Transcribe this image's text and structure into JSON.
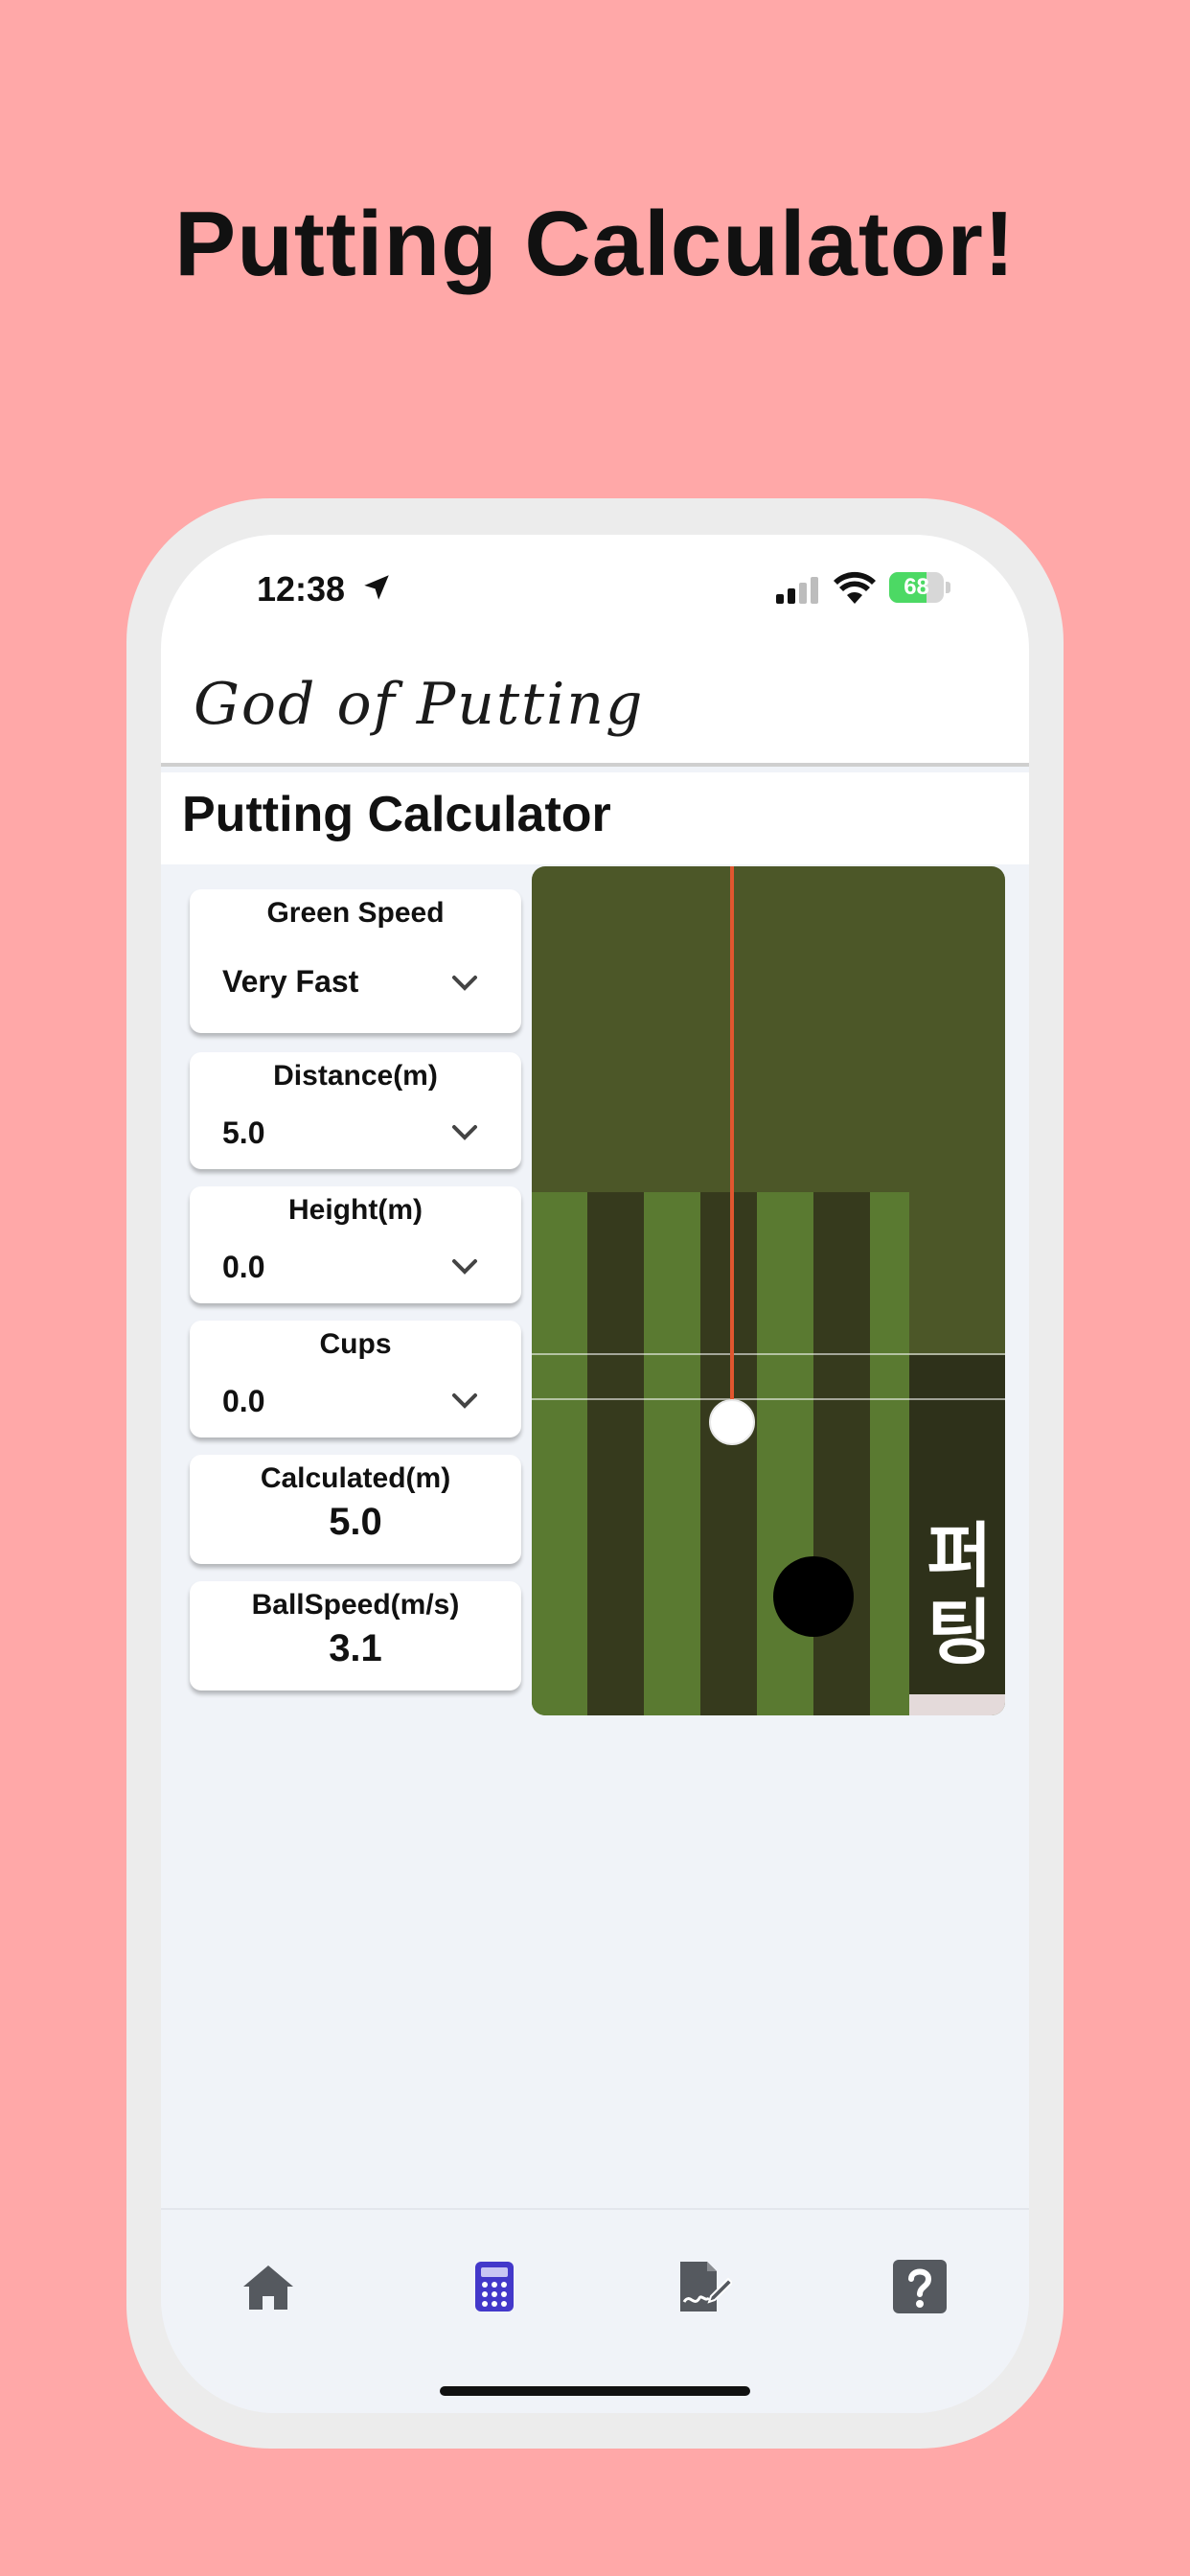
{
  "promo": {
    "title": "Putting Calculator!"
  },
  "status_bar": {
    "time": "12:38",
    "battery": "68",
    "battery_level": 0.68
  },
  "header": {
    "app_title": "God of Putting"
  },
  "page": {
    "title": "Putting Calculator"
  },
  "controls": {
    "green_speed": {
      "label": "Green Speed",
      "value": "Very Fast"
    },
    "distance": {
      "label": "Distance(m)",
      "value": "5.0"
    },
    "height": {
      "label": "Height(m)",
      "value": "0.0"
    },
    "cups": {
      "label": "Cups",
      "value": "0.0"
    }
  },
  "results": {
    "calculated": {
      "label": "Calculated(m)",
      "value": "5.0"
    },
    "ball_speed": {
      "label": "BallSpeed(m/s)",
      "value": "3.1"
    }
  },
  "visual": {
    "side_label": "퍼팅"
  },
  "nav": {
    "items": [
      {
        "icon": "home-icon"
      },
      {
        "icon": "calculator-icon",
        "active": true
      },
      {
        "icon": "signature-doc-icon"
      },
      {
        "icon": "question-icon"
      }
    ]
  },
  "colors": {
    "background": "#ffa8a8",
    "accent": "#4338ca",
    "nav_icon": "#55595f",
    "aim_line": "#e0562f"
  }
}
